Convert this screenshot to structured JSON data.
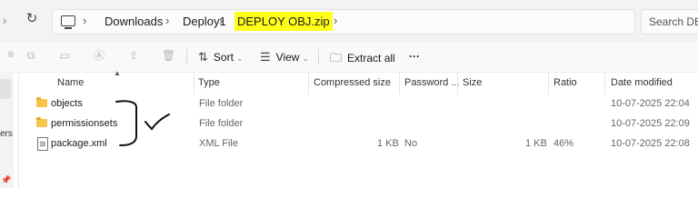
{
  "breadcrumb": {
    "items": [
      "Downloads",
      "Deploy1"
    ],
    "current": "DEPLOY OBJ.zip"
  },
  "search": {
    "placeholder": "Search DEP"
  },
  "toolbar": {
    "sort_label": "Sort",
    "view_label": "View",
    "extract_label": "Extract all",
    "more_label": "···"
  },
  "columns": {
    "name": "Name",
    "type": "Type",
    "compressed_size": "Compressed size",
    "password": "Password ...",
    "size": "Size",
    "ratio": "Ratio",
    "date_modified": "Date modified"
  },
  "files": [
    {
      "name": "objects",
      "type": "File folder",
      "compressed_size": "",
      "password": "",
      "size": "",
      "ratio": "",
      "date": "10-07-2025 22:04",
      "icon": "folder-icon"
    },
    {
      "name": "permissionsets",
      "type": "File folder",
      "compressed_size": "",
      "password": "",
      "size": "",
      "ratio": "",
      "date": "10-07-2025 22:09",
      "icon": "folder-icon"
    },
    {
      "name": "package.xml",
      "type": "XML File",
      "compressed_size": "1 KB",
      "password": "No",
      "size": "1 KB",
      "ratio": "46%",
      "date": "10-07-2025 22:08",
      "icon": "file-icon"
    }
  ],
  "left_pane": {
    "fragment": "ers"
  },
  "colors": {
    "highlight": "#ffff1a",
    "folder": "#f7c44a"
  }
}
